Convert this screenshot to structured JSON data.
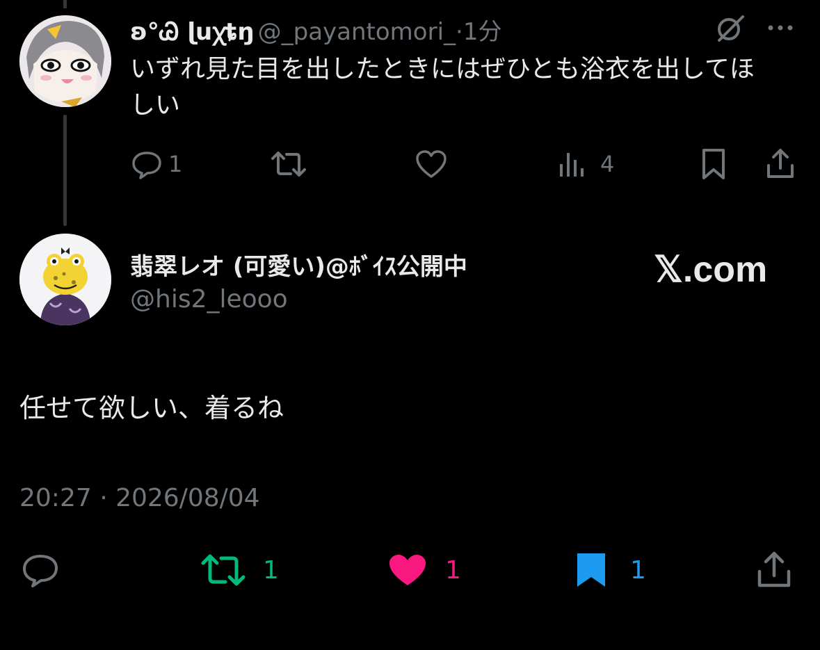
{
  "reply_to": {
    "display_name": "ʚ°Ꮚ ɭuꭓȶŋ",
    "handle": "@_payantomori_",
    "time": "·1分",
    "text": "いずれ見た目を出したときにはぜひとも浴衣を出してほしい",
    "actions": {
      "replies": "1",
      "views": "4"
    }
  },
  "main": {
    "display_name": "翡翠レオ (可愛い)@ﾎﾞｲｽ公開中",
    "handle": "@his2_leooo",
    "brand": "𝕏.com",
    "text": "任せて欲しい、着るね",
    "timestamp": "20:27 · 2026/08/04",
    "actions": {
      "reposts": "1",
      "likes": "1",
      "bookmarks": "1"
    }
  },
  "colors": {
    "repost": "#00ba7c",
    "like": "#f91880",
    "bookmark": "#1d9bf0",
    "muted": "#71767b"
  },
  "icons": [
    "reply-icon",
    "repost-icon",
    "like-icon",
    "views-icon",
    "bookmark-icon",
    "share-icon",
    "grok-icon",
    "more-icon"
  ]
}
